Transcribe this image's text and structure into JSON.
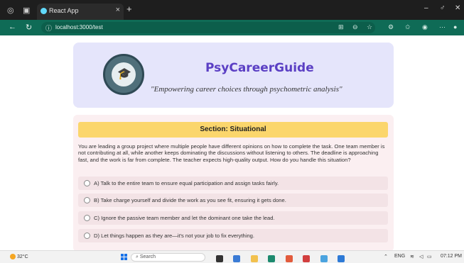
{
  "browser": {
    "tab_title": "React App",
    "tab_close": "×",
    "new_tab": "+",
    "url": "localhost:3000/test",
    "window_controls": {
      "minimize": "–",
      "maximize": "♂",
      "close": "✕"
    }
  },
  "header": {
    "brand": "PsyCareerGuide",
    "tagline": "\"Empowering career choices through psychometric analysis\""
  },
  "section": {
    "title": "Section: Situational"
  },
  "question": {
    "text": "You are leading a group project where multiple people have different opinions on how to complete the task. One team member is not contributing at all, while another keeps dominating the discussions without listening to others. The deadline is approaching fast, and the work is far from complete. The teacher expects high-quality output. How do you handle this situation?",
    "options": [
      "A) Talk to the entire team to ensure equal participation and assign tasks fairly.",
      "B) Take charge yourself and divide the work as you see fit, ensuring it gets done.",
      "C) Ignore the passive team member and let the dominant one take the lead.",
      "D) Let things happen as they are—it's not your job to fix everything."
    ]
  },
  "taskbar": {
    "temperature": "32°C",
    "search_placeholder": "Search",
    "language": "ENG",
    "time": "07:12 PM"
  },
  "colors": {
    "brand": "#5b3fc4",
    "header_bg": "#e5e5fb",
    "section_bg": "#fbd66c",
    "card_bg": "#fbeff1",
    "address_bar": "#0f6b56"
  }
}
